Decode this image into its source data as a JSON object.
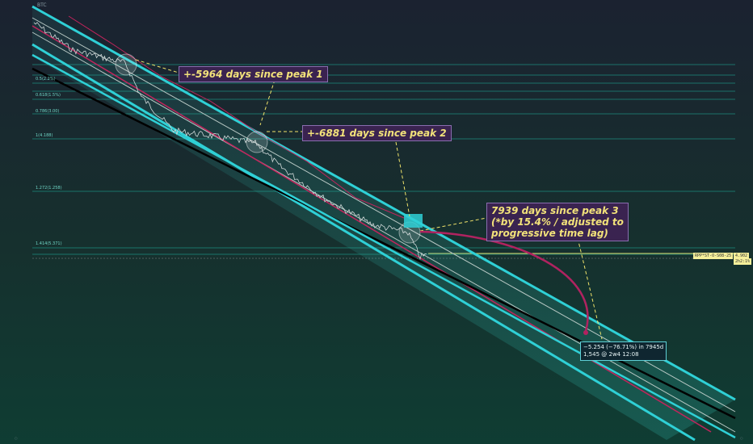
{
  "chart_data": {
    "type": "line",
    "title": "BTC",
    "annotations": [
      "+-5964 days since peak 1",
      "+-6881 days since peak 2",
      "7939 days since peak 3\n(*by 15.4% / adjusted to\nprogressive time lag)"
    ],
    "measure_tooltip": {
      "line1": "−5.254 (−76.71%) in 7945d",
      "line2": "1,545 @ 2w4 12:08"
    },
    "fib_levels": [
      {
        "label": "0.5(2.2%)"
      },
      {
        "label": "0.618(1.5%)"
      },
      {
        "label": "0.786(3.00)"
      },
      {
        "label": "1(4.188)"
      },
      {
        "label": "1.272(1.258)"
      },
      {
        "label": "1.414(5.371)"
      }
    ],
    "price_tags": {
      "current": "4.902",
      "secondary": "2h2:1%",
      "line_label": "RPP*ST-O-S08-25"
    },
    "grid": false,
    "legend": "none"
  },
  "colors": {
    "channel": "#2fd0d6",
    "inner": "#b9c9c5",
    "red": "#c2245c",
    "black": "#000000",
    "fib": "#1fb5a0",
    "price": "#e3dc6a",
    "arc": "#b02360"
  }
}
